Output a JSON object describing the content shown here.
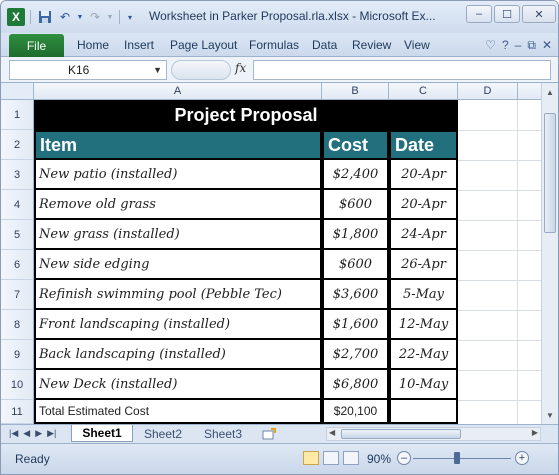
{
  "window": {
    "title": "Worksheet in Parker Proposal.rla.xlsx  -  Microsoft Ex...",
    "minimize": "–",
    "maximize": "☐",
    "close": "✕"
  },
  "qat": {
    "logo": "X",
    "save_icon": "save-icon",
    "undo_icon": "undo-icon",
    "redo_icon": "redo-icon"
  },
  "ribbon": {
    "file_tab": "File",
    "tabs": [
      "Home",
      "Insert",
      "Page Layout",
      "Formulas",
      "Data",
      "Review",
      "View"
    ],
    "right_icons": [
      "♡",
      "?",
      "–",
      "⧉",
      "✕"
    ]
  },
  "formula_bar": {
    "name_box": "K16",
    "fx": "fx",
    "formula": ""
  },
  "columns": [
    "A",
    "B",
    "C",
    "D"
  ],
  "rows": [
    "1",
    "2",
    "3",
    "4",
    "5",
    "6",
    "7",
    "8",
    "9",
    "10",
    "11"
  ],
  "sheet": {
    "title": "Project Proposal",
    "headers": {
      "item": "Item",
      "cost": "Cost",
      "date": "Date"
    },
    "items": [
      {
        "item": "New patio (installed)",
        "cost": "$2,400",
        "date": "20-Apr"
      },
      {
        "item": "Remove old grass",
        "cost": "$600",
        "date": "20-Apr"
      },
      {
        "item": "New grass (installed)",
        "cost": "$1,800",
        "date": "24-Apr"
      },
      {
        "item": "New side edging",
        "cost": "$600",
        "date": "26-Apr"
      },
      {
        "item": "Refinish swimming pool (Pebble Tec)",
        "cost": "$3,600",
        "date": "5-May"
      },
      {
        "item": "Front landscaping (installed)",
        "cost": "$1,600",
        "date": "12-May"
      },
      {
        "item": "Back landscaping (installed)",
        "cost": "$2,700",
        "date": "22-May"
      },
      {
        "item": "New Deck (installed)",
        "cost": "$6,800",
        "date": "10-May"
      }
    ],
    "total": {
      "label": "Total Estimated Cost",
      "cost": "$20,100",
      "date": ""
    }
  },
  "sheet_tabs": [
    "Sheet1",
    "Sheet2",
    "Sheet3"
  ],
  "active_sheet": "Sheet1",
  "status": {
    "ready": "Ready",
    "zoom": "90%",
    "zoom_level_percent": 90,
    "zoom_out": "–",
    "zoom_in": "+"
  },
  "colors": {
    "title_fill": "#000000",
    "header_fill": "#226f7d",
    "file_tab": "#1e6b2d"
  }
}
